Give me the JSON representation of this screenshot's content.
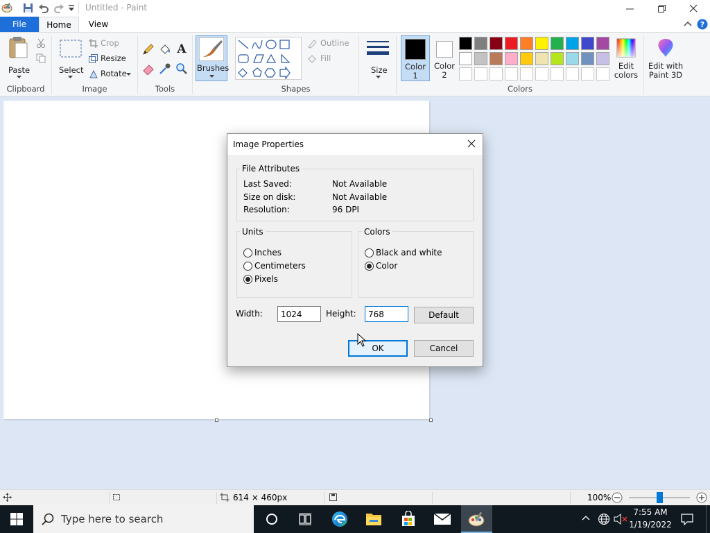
{
  "window": {
    "title": "Untitled - Paint"
  },
  "ribbon": {
    "tabs": [
      "File",
      "Home",
      "View"
    ],
    "clipboard": {
      "paste": "Paste",
      "group": "Clipboard"
    },
    "image": {
      "select": "Select",
      "crop": "Crop",
      "resize": "Resize",
      "rotate": "Rotate",
      "group": "Image"
    },
    "tools": {
      "group": "Tools"
    },
    "brushes": {
      "label": "Brushes"
    },
    "shapes": {
      "outline": "Outline",
      "fill": "Fill",
      "group": "Shapes"
    },
    "size": {
      "label": "Size"
    },
    "colors": {
      "color1": "Color 1",
      "color2": "Color 2",
      "group": "Colors",
      "edit_colors": "Edit colors",
      "edit_with": "Edit with Paint 3D",
      "color1_value": "#000000",
      "color2_value": "#ffffff",
      "palette_row1": [
        "#000000",
        "#7f7f7f",
        "#880015",
        "#ed1c24",
        "#ff7f27",
        "#fff200",
        "#22b14c",
        "#00a2e8",
        "#3f48cc",
        "#a349a4"
      ],
      "palette_row2": [
        "#ffffff",
        "#c3c3c3",
        "#b97a57",
        "#ffaec9",
        "#ffc90e",
        "#efe4b0",
        "#b5e61d",
        "#99d9ea",
        "#7092be",
        "#c8bfe7"
      ]
    }
  },
  "dialog": {
    "title": "Image Properties",
    "file_attributes": {
      "legend": "File Attributes",
      "rows": [
        {
          "label": "Last Saved:",
          "value": "Not Available"
        },
        {
          "label": "Size on disk:",
          "value": "Not Available"
        },
        {
          "label": "Resolution:",
          "value": "96 DPI"
        }
      ]
    },
    "units": {
      "legend": "Units",
      "options": [
        "Inches",
        "Centimeters",
        "Pixels"
      ],
      "selected": "Pixels"
    },
    "colors": {
      "legend": "Colors",
      "options": [
        "Black and white",
        "Color"
      ],
      "selected": "Color"
    },
    "width_label": "Width:",
    "width_value": "1024",
    "height_label": "Height:",
    "height_value": "768",
    "default_button": "Default",
    "ok_button": "OK",
    "cancel_button": "Cancel"
  },
  "statusbar": {
    "canvas_size": "614 × 460px",
    "zoom": "100%",
    "zoom_fraction": 0.5
  },
  "taskbar": {
    "search_placeholder": "Type here to search",
    "time": "7:55 AM",
    "date": "1/19/2022"
  }
}
